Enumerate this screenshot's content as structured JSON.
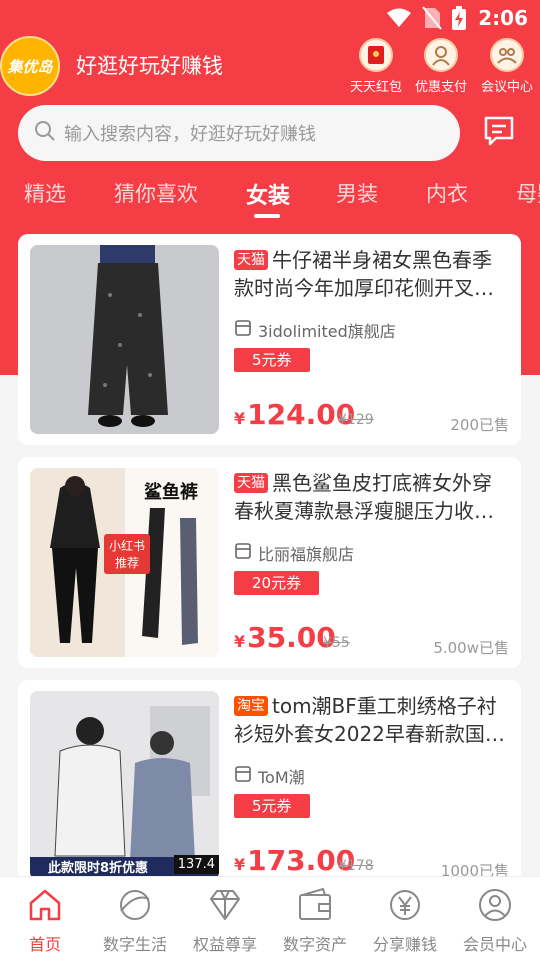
{
  "status_bar": {
    "time": "2:06"
  },
  "header": {
    "logo_text": "集优岛",
    "slogan": "好逛好玩好赚钱",
    "quick_links": [
      {
        "label": "天天红包",
        "icon": "red-envelope-icon"
      },
      {
        "label": "优惠支付",
        "icon": "avatar-icon"
      },
      {
        "label": "会议中心",
        "icon": "meeting-icon"
      }
    ]
  },
  "search": {
    "placeholder": "输入搜索内容，好逛好玩好赚钱"
  },
  "tabs": [
    {
      "label": "精选"
    },
    {
      "label": "猜你喜欢"
    },
    {
      "label": "女装",
      "active": true
    },
    {
      "label": "男装"
    },
    {
      "label": "内衣"
    },
    {
      "label": "母婴"
    }
  ],
  "products": [
    {
      "platform": "天猫",
      "title": "牛仔裙半身裙女黑色春季款时尚今年加厚印花侧开叉…",
      "shop": "3idolimited旗舰店",
      "coupon": "5元券",
      "price_symbol": "¥",
      "price": "124.00",
      "original_price": "¥129",
      "sold": "200已售"
    },
    {
      "platform": "天猫",
      "title": "黑色鲨鱼皮打底裤女外穿春秋夏薄款悬浮瘦腿压力收…",
      "shop": "比丽福旗舰店",
      "coupon": "20元券",
      "price_symbol": "¥",
      "price": "35.00",
      "original_price": "¥55",
      "sold": "5.00w已售",
      "image_text": {
        "top": "鲨鱼裤",
        "badge": "小红书",
        "badge_sub": "推荐"
      }
    },
    {
      "platform": "淘宝",
      "title": "tom潮BF重工刺绣格子衬衫短外套女2022早春新款国…",
      "shop": "ToM潮",
      "coupon": "5元券",
      "price_symbol": "¥",
      "price": "173.00",
      "original_price": "¥178",
      "sold": "1000已售",
      "image_text": {
        "banner": "此款限时8折优惠",
        "price_tag": "137.4"
      }
    }
  ],
  "bottom_nav": [
    {
      "label": "首页",
      "icon": "home-icon",
      "active": true
    },
    {
      "label": "数字生活",
      "icon": "planet-icon"
    },
    {
      "label": "权益尊享",
      "icon": "diamond-icon"
    },
    {
      "label": "数字资产",
      "icon": "wallet-icon"
    },
    {
      "label": "分享赚钱",
      "icon": "yen-coin-icon"
    },
    {
      "label": "会员中心",
      "icon": "user-icon"
    }
  ]
}
